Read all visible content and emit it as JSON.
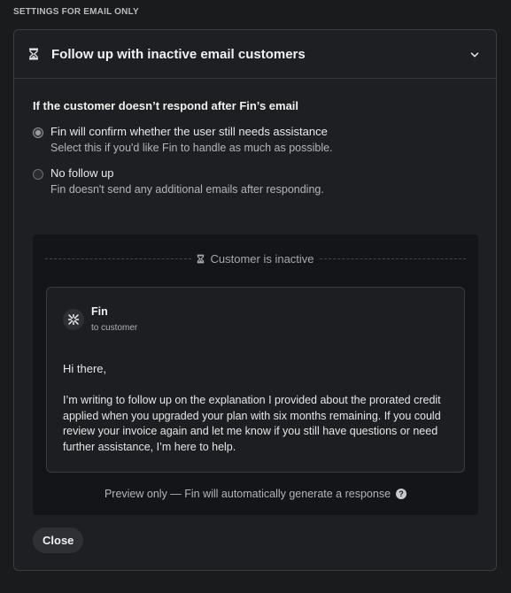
{
  "section_heading": "SETTINGS FOR EMAIL ONLY",
  "panel": {
    "title": "Follow up with inactive email customers",
    "question": "If the customer doesn’t respond after Fin’s email",
    "options": [
      {
        "title": "Fin will confirm whether the user still needs assistance",
        "description": "Select this if you'd like Fin to handle as much as possible.",
        "selected": true
      },
      {
        "title": "No follow up",
        "description": "Fin doesn't send any additional emails after responding.",
        "selected": false
      }
    ]
  },
  "preview": {
    "divider_label": "Customer is inactive",
    "email": {
      "sender": "Fin",
      "recipient": "to customer",
      "greeting": "Hi there,",
      "message": "I’m writing to follow up on the explanation I provided about the prorated credit applied when you upgraded your plan with six months remaining. If you could review your invoice again and let me know if you still have questions or need further assistance, I’m here to help."
    },
    "note": "Preview only — Fin will automatically generate a response"
  },
  "close_label": "Close",
  "icons": {
    "header": "hourglass-icon",
    "collapse": "chevron-down-icon",
    "inactive": "hourglass-icon",
    "avatar": "fin-logo-icon",
    "help": "question-icon"
  }
}
